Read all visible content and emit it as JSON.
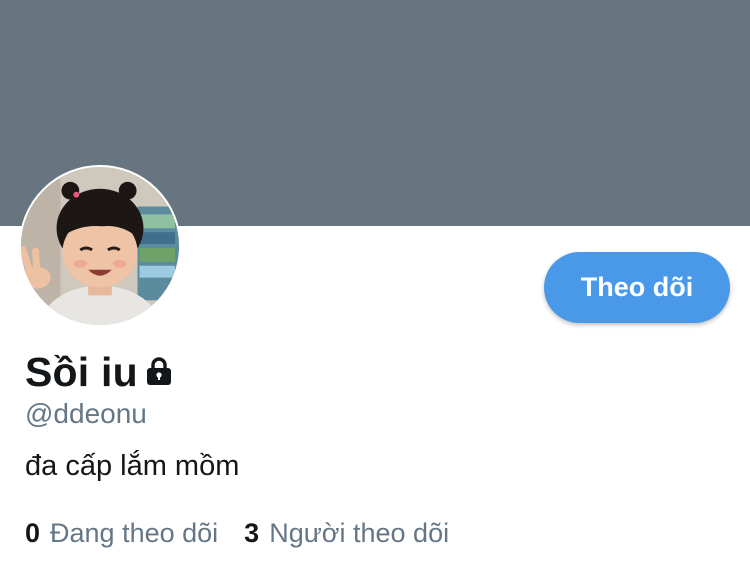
{
  "profile": {
    "display_name": "Sồi iu",
    "handle": "@ddeonu",
    "bio": "đa cấp lắm mồm",
    "protected_icon": "lock-icon",
    "avatar": "profile-photo",
    "follow_button_label": "Theo dõi",
    "stats": {
      "following_count": "0",
      "following_label": "Đang theo dõi",
      "followers_count": "3",
      "followers_label": "Người theo dõi"
    }
  },
  "colors": {
    "banner": "#66757f",
    "accent": "#4a99e9",
    "text_primary": "#14171a",
    "text_secondary": "#657786"
  }
}
